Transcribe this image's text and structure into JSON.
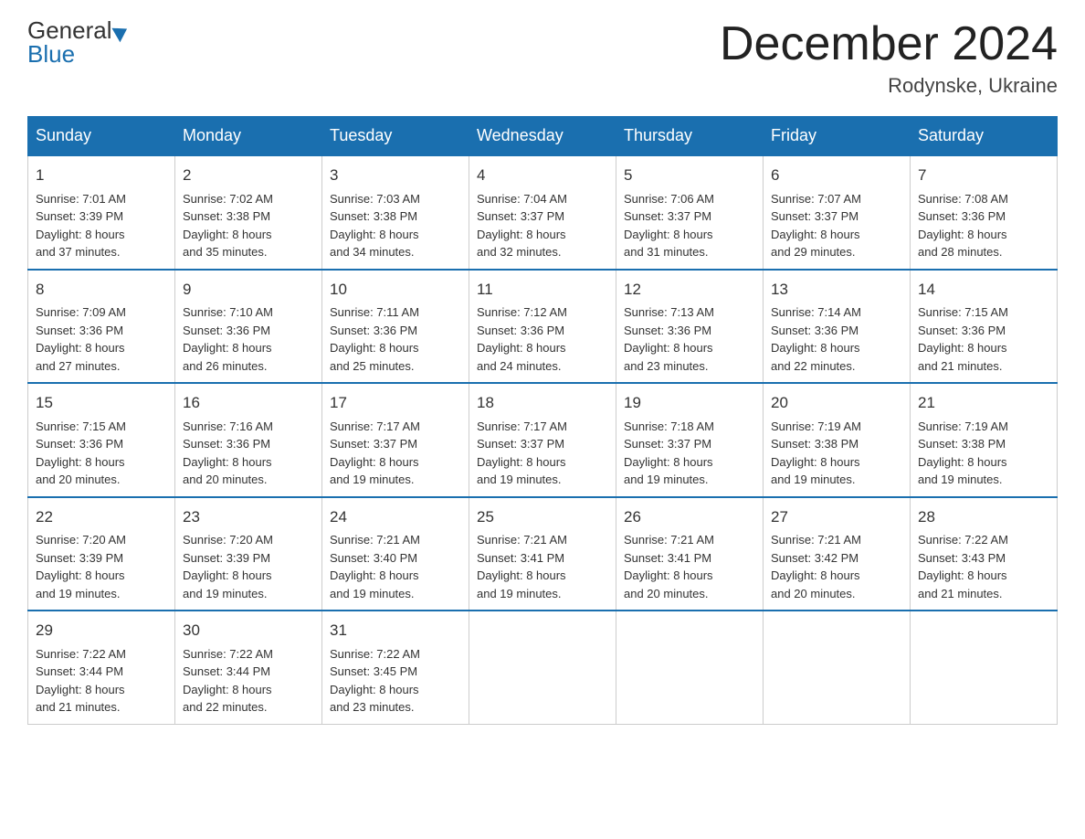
{
  "logo": {
    "line1": "General",
    "line2": "Blue"
  },
  "title": "December 2024",
  "location": "Rodynske, Ukraine",
  "days_header": [
    "Sunday",
    "Monday",
    "Tuesday",
    "Wednesday",
    "Thursday",
    "Friday",
    "Saturday"
  ],
  "weeks": [
    [
      {
        "day": "1",
        "lines": [
          "Sunrise: 7:01 AM",
          "Sunset: 3:39 PM",
          "Daylight: 8 hours",
          "and 37 minutes."
        ]
      },
      {
        "day": "2",
        "lines": [
          "Sunrise: 7:02 AM",
          "Sunset: 3:38 PM",
          "Daylight: 8 hours",
          "and 35 minutes."
        ]
      },
      {
        "day": "3",
        "lines": [
          "Sunrise: 7:03 AM",
          "Sunset: 3:38 PM",
          "Daylight: 8 hours",
          "and 34 minutes."
        ]
      },
      {
        "day": "4",
        "lines": [
          "Sunrise: 7:04 AM",
          "Sunset: 3:37 PM",
          "Daylight: 8 hours",
          "and 32 minutes."
        ]
      },
      {
        "day": "5",
        "lines": [
          "Sunrise: 7:06 AM",
          "Sunset: 3:37 PM",
          "Daylight: 8 hours",
          "and 31 minutes."
        ]
      },
      {
        "day": "6",
        "lines": [
          "Sunrise: 7:07 AM",
          "Sunset: 3:37 PM",
          "Daylight: 8 hours",
          "and 29 minutes."
        ]
      },
      {
        "day": "7",
        "lines": [
          "Sunrise: 7:08 AM",
          "Sunset: 3:36 PM",
          "Daylight: 8 hours",
          "and 28 minutes."
        ]
      }
    ],
    [
      {
        "day": "8",
        "lines": [
          "Sunrise: 7:09 AM",
          "Sunset: 3:36 PM",
          "Daylight: 8 hours",
          "and 27 minutes."
        ]
      },
      {
        "day": "9",
        "lines": [
          "Sunrise: 7:10 AM",
          "Sunset: 3:36 PM",
          "Daylight: 8 hours",
          "and 26 minutes."
        ]
      },
      {
        "day": "10",
        "lines": [
          "Sunrise: 7:11 AM",
          "Sunset: 3:36 PM",
          "Daylight: 8 hours",
          "and 25 minutes."
        ]
      },
      {
        "day": "11",
        "lines": [
          "Sunrise: 7:12 AM",
          "Sunset: 3:36 PM",
          "Daylight: 8 hours",
          "and 24 minutes."
        ]
      },
      {
        "day": "12",
        "lines": [
          "Sunrise: 7:13 AM",
          "Sunset: 3:36 PM",
          "Daylight: 8 hours",
          "and 23 minutes."
        ]
      },
      {
        "day": "13",
        "lines": [
          "Sunrise: 7:14 AM",
          "Sunset: 3:36 PM",
          "Daylight: 8 hours",
          "and 22 minutes."
        ]
      },
      {
        "day": "14",
        "lines": [
          "Sunrise: 7:15 AM",
          "Sunset: 3:36 PM",
          "Daylight: 8 hours",
          "and 21 minutes."
        ]
      }
    ],
    [
      {
        "day": "15",
        "lines": [
          "Sunrise: 7:15 AM",
          "Sunset: 3:36 PM",
          "Daylight: 8 hours",
          "and 20 minutes."
        ]
      },
      {
        "day": "16",
        "lines": [
          "Sunrise: 7:16 AM",
          "Sunset: 3:36 PM",
          "Daylight: 8 hours",
          "and 20 minutes."
        ]
      },
      {
        "day": "17",
        "lines": [
          "Sunrise: 7:17 AM",
          "Sunset: 3:37 PM",
          "Daylight: 8 hours",
          "and 19 minutes."
        ]
      },
      {
        "day": "18",
        "lines": [
          "Sunrise: 7:17 AM",
          "Sunset: 3:37 PM",
          "Daylight: 8 hours",
          "and 19 minutes."
        ]
      },
      {
        "day": "19",
        "lines": [
          "Sunrise: 7:18 AM",
          "Sunset: 3:37 PM",
          "Daylight: 8 hours",
          "and 19 minutes."
        ]
      },
      {
        "day": "20",
        "lines": [
          "Sunrise: 7:19 AM",
          "Sunset: 3:38 PM",
          "Daylight: 8 hours",
          "and 19 minutes."
        ]
      },
      {
        "day": "21",
        "lines": [
          "Sunrise: 7:19 AM",
          "Sunset: 3:38 PM",
          "Daylight: 8 hours",
          "and 19 minutes."
        ]
      }
    ],
    [
      {
        "day": "22",
        "lines": [
          "Sunrise: 7:20 AM",
          "Sunset: 3:39 PM",
          "Daylight: 8 hours",
          "and 19 minutes."
        ]
      },
      {
        "day": "23",
        "lines": [
          "Sunrise: 7:20 AM",
          "Sunset: 3:39 PM",
          "Daylight: 8 hours",
          "and 19 minutes."
        ]
      },
      {
        "day": "24",
        "lines": [
          "Sunrise: 7:21 AM",
          "Sunset: 3:40 PM",
          "Daylight: 8 hours",
          "and 19 minutes."
        ]
      },
      {
        "day": "25",
        "lines": [
          "Sunrise: 7:21 AM",
          "Sunset: 3:41 PM",
          "Daylight: 8 hours",
          "and 19 minutes."
        ]
      },
      {
        "day": "26",
        "lines": [
          "Sunrise: 7:21 AM",
          "Sunset: 3:41 PM",
          "Daylight: 8 hours",
          "and 20 minutes."
        ]
      },
      {
        "day": "27",
        "lines": [
          "Sunrise: 7:21 AM",
          "Sunset: 3:42 PM",
          "Daylight: 8 hours",
          "and 20 minutes."
        ]
      },
      {
        "day": "28",
        "lines": [
          "Sunrise: 7:22 AM",
          "Sunset: 3:43 PM",
          "Daylight: 8 hours",
          "and 21 minutes."
        ]
      }
    ],
    [
      {
        "day": "29",
        "lines": [
          "Sunrise: 7:22 AM",
          "Sunset: 3:44 PM",
          "Daylight: 8 hours",
          "and 21 minutes."
        ]
      },
      {
        "day": "30",
        "lines": [
          "Sunrise: 7:22 AM",
          "Sunset: 3:44 PM",
          "Daylight: 8 hours",
          "and 22 minutes."
        ]
      },
      {
        "day": "31",
        "lines": [
          "Sunrise: 7:22 AM",
          "Sunset: 3:45 PM",
          "Daylight: 8 hours",
          "and 23 minutes."
        ]
      },
      {
        "day": "",
        "lines": []
      },
      {
        "day": "",
        "lines": []
      },
      {
        "day": "",
        "lines": []
      },
      {
        "day": "",
        "lines": []
      }
    ]
  ]
}
